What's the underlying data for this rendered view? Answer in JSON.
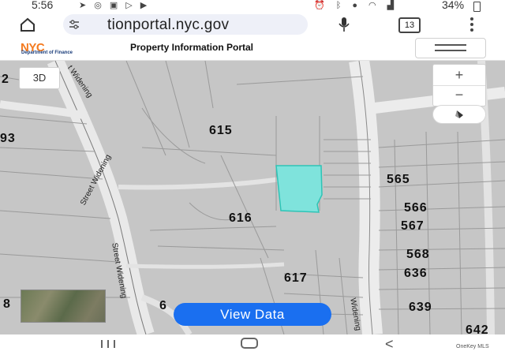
{
  "status_bar": {
    "time": "5:56",
    "battery_percent": "34%",
    "icons_left": [
      "navigation-icon",
      "whatsapp-icon",
      "shop-icon",
      "play-icon",
      "youtube-icon"
    ],
    "icons_right": [
      "alarm-icon",
      "bluetooth-icon",
      "location-icon",
      "wifi-icon",
      "signal-icon"
    ]
  },
  "browser": {
    "url": "tionportal.nyc.gov",
    "tab_count": "13"
  },
  "header": {
    "logo": "NYC",
    "logo_sub": "Department of Finance",
    "title": "Property Information Portal",
    "accent_color": "#f47b20",
    "logo_sub_color": "#1a3d7a"
  },
  "map": {
    "btn_3d": "3D",
    "zoom_in": "+",
    "zoom_out": "−",
    "selected_parcel_color": "#7fe3dc",
    "lot_labels": {
      "l615": "615",
      "l616": "616",
      "l617": "617",
      "l565": "565",
      "l566": "566",
      "l567": "567",
      "l568": "568",
      "l636": "636",
      "l639": "639",
      "l93": "93",
      "l2": "2",
      "l8": "8",
      "l6": "6",
      "l642": "642"
    },
    "street_labels": {
      "street_widening_1": "Street Widening",
      "street_widening_2": "Street Widening",
      "widening_top": "t Widening",
      "widening_bottom": "Widening"
    }
  },
  "actions": {
    "view_data": "View Data"
  },
  "watermark": "OneKey MLS"
}
